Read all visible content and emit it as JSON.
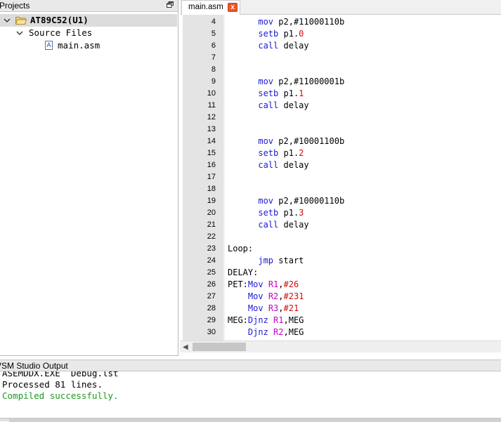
{
  "projects_pane": {
    "title": "Projects",
    "tree": {
      "project_label": "AT89C52(U1)",
      "folder_label": "Source Files",
      "file_label": "main.asm",
      "file_icon_letter": "A"
    }
  },
  "editor": {
    "tab_label": "main.asm",
    "tab_close_glyph": "x",
    "lines": [
      {
        "n": "4",
        "parts": [
          {
            "t": "      ",
            "c": "plain"
          },
          {
            "t": "mov",
            "c": "kw"
          },
          {
            "t": " p2,",
            "c": "plain"
          },
          {
            "t": "#11000110b",
            "c": "plain"
          }
        ]
      },
      {
        "n": "5",
        "parts": [
          {
            "t": "      ",
            "c": "plain"
          },
          {
            "t": "setb",
            "c": "kw"
          },
          {
            "t": " p1.",
            "c": "plain"
          },
          {
            "t": "0",
            "c": "num"
          }
        ]
      },
      {
        "n": "6",
        "parts": [
          {
            "t": "      ",
            "c": "plain"
          },
          {
            "t": "call",
            "c": "kw"
          },
          {
            "t": " delay",
            "c": "plain"
          }
        ]
      },
      {
        "n": "7",
        "parts": []
      },
      {
        "n": "8",
        "parts": []
      },
      {
        "n": "9",
        "parts": [
          {
            "t": "      ",
            "c": "plain"
          },
          {
            "t": "mov",
            "c": "kw"
          },
          {
            "t": " p2,",
            "c": "plain"
          },
          {
            "t": "#11000001b",
            "c": "plain"
          }
        ]
      },
      {
        "n": "10",
        "parts": [
          {
            "t": "      ",
            "c": "plain"
          },
          {
            "t": "setb",
            "c": "kw"
          },
          {
            "t": " p1.",
            "c": "plain"
          },
          {
            "t": "1",
            "c": "num"
          }
        ]
      },
      {
        "n": "11",
        "parts": [
          {
            "t": "      ",
            "c": "plain"
          },
          {
            "t": "call",
            "c": "kw"
          },
          {
            "t": " delay",
            "c": "plain"
          }
        ]
      },
      {
        "n": "12",
        "parts": []
      },
      {
        "n": "13",
        "parts": []
      },
      {
        "n": "14",
        "parts": [
          {
            "t": "      ",
            "c": "plain"
          },
          {
            "t": "mov",
            "c": "kw"
          },
          {
            "t": " p2,",
            "c": "plain"
          },
          {
            "t": "#10001100b",
            "c": "plain"
          }
        ]
      },
      {
        "n": "15",
        "parts": [
          {
            "t": "      ",
            "c": "plain"
          },
          {
            "t": "setb",
            "c": "kw"
          },
          {
            "t": " p1.",
            "c": "plain"
          },
          {
            "t": "2",
            "c": "num"
          }
        ]
      },
      {
        "n": "16",
        "parts": [
          {
            "t": "      ",
            "c": "plain"
          },
          {
            "t": "call",
            "c": "kw"
          },
          {
            "t": " delay",
            "c": "plain"
          }
        ]
      },
      {
        "n": "17",
        "parts": []
      },
      {
        "n": "18",
        "parts": []
      },
      {
        "n": "19",
        "parts": [
          {
            "t": "      ",
            "c": "plain"
          },
          {
            "t": "mov",
            "c": "kw"
          },
          {
            "t": " p2,",
            "c": "plain"
          },
          {
            "t": "#10000110b",
            "c": "plain"
          }
        ]
      },
      {
        "n": "20",
        "parts": [
          {
            "t": "      ",
            "c": "plain"
          },
          {
            "t": "setb",
            "c": "kw"
          },
          {
            "t": " p1.",
            "c": "plain"
          },
          {
            "t": "3",
            "c": "num"
          }
        ]
      },
      {
        "n": "21",
        "parts": [
          {
            "t": "      ",
            "c": "plain"
          },
          {
            "t": "call",
            "c": "kw"
          },
          {
            "t": " delay",
            "c": "plain"
          }
        ]
      },
      {
        "n": "22",
        "parts": []
      },
      {
        "n": "23",
        "parts": [
          {
            "t": "Loop:",
            "c": "plain"
          }
        ]
      },
      {
        "n": "24",
        "parts": [
          {
            "t": "      ",
            "c": "plain"
          },
          {
            "t": "jmp",
            "c": "kw"
          },
          {
            "t": " start",
            "c": "plain"
          }
        ]
      },
      {
        "n": "25",
        "parts": [
          {
            "t": "DELAY:",
            "c": "plain"
          }
        ]
      },
      {
        "n": "26",
        "parts": [
          {
            "t": "PET:",
            "c": "plain"
          },
          {
            "t": "Mov",
            "c": "kw"
          },
          {
            "t": " ",
            "c": "plain"
          },
          {
            "t": "R1",
            "c": "reg"
          },
          {
            "t": ",",
            "c": "plain"
          },
          {
            "t": "#26",
            "c": "num"
          }
        ]
      },
      {
        "n": "27",
        "parts": [
          {
            "t": "    ",
            "c": "plain"
          },
          {
            "t": "Mov",
            "c": "kw"
          },
          {
            "t": " ",
            "c": "plain"
          },
          {
            "t": "R2",
            "c": "reg"
          },
          {
            "t": ",",
            "c": "plain"
          },
          {
            "t": "#231",
            "c": "num"
          }
        ]
      },
      {
        "n": "28",
        "parts": [
          {
            "t": "    ",
            "c": "plain"
          },
          {
            "t": "Mov",
            "c": "kw"
          },
          {
            "t": " ",
            "c": "plain"
          },
          {
            "t": "R3",
            "c": "reg"
          },
          {
            "t": ",",
            "c": "plain"
          },
          {
            "t": "#21",
            "c": "num"
          }
        ]
      },
      {
        "n": "29",
        "parts": [
          {
            "t": "MEG:",
            "c": "plain"
          },
          {
            "t": "Djnz",
            "c": "kw"
          },
          {
            "t": " ",
            "c": "plain"
          },
          {
            "t": "R1",
            "c": "reg"
          },
          {
            "t": ",MEG",
            "c": "plain"
          }
        ]
      },
      {
        "n": "30",
        "parts": [
          {
            "t": "    ",
            "c": "plain"
          },
          {
            "t": "Djnz",
            "c": "kw"
          },
          {
            "t": " ",
            "c": "plain"
          },
          {
            "t": "R2",
            "c": "reg"
          },
          {
            "t": ",MEG",
            "c": "plain"
          }
        ]
      }
    ]
  },
  "output_pane": {
    "title": "VSM Studio Output",
    "lines": [
      {
        "text": "ASEMDDX.EXE  Debug.lst",
        "color": "#000000"
      },
      {
        "text": "Processed 81 lines.",
        "color": "#000000"
      },
      {
        "text": "Compiled successfully.",
        "color": "#1f9a1f"
      }
    ]
  },
  "colors": {
    "keyword": "#1a1ad6",
    "number": "#d40a0a",
    "register": "#c800c8",
    "success": "#1f9a1f",
    "tab_close": "#e9562a"
  }
}
